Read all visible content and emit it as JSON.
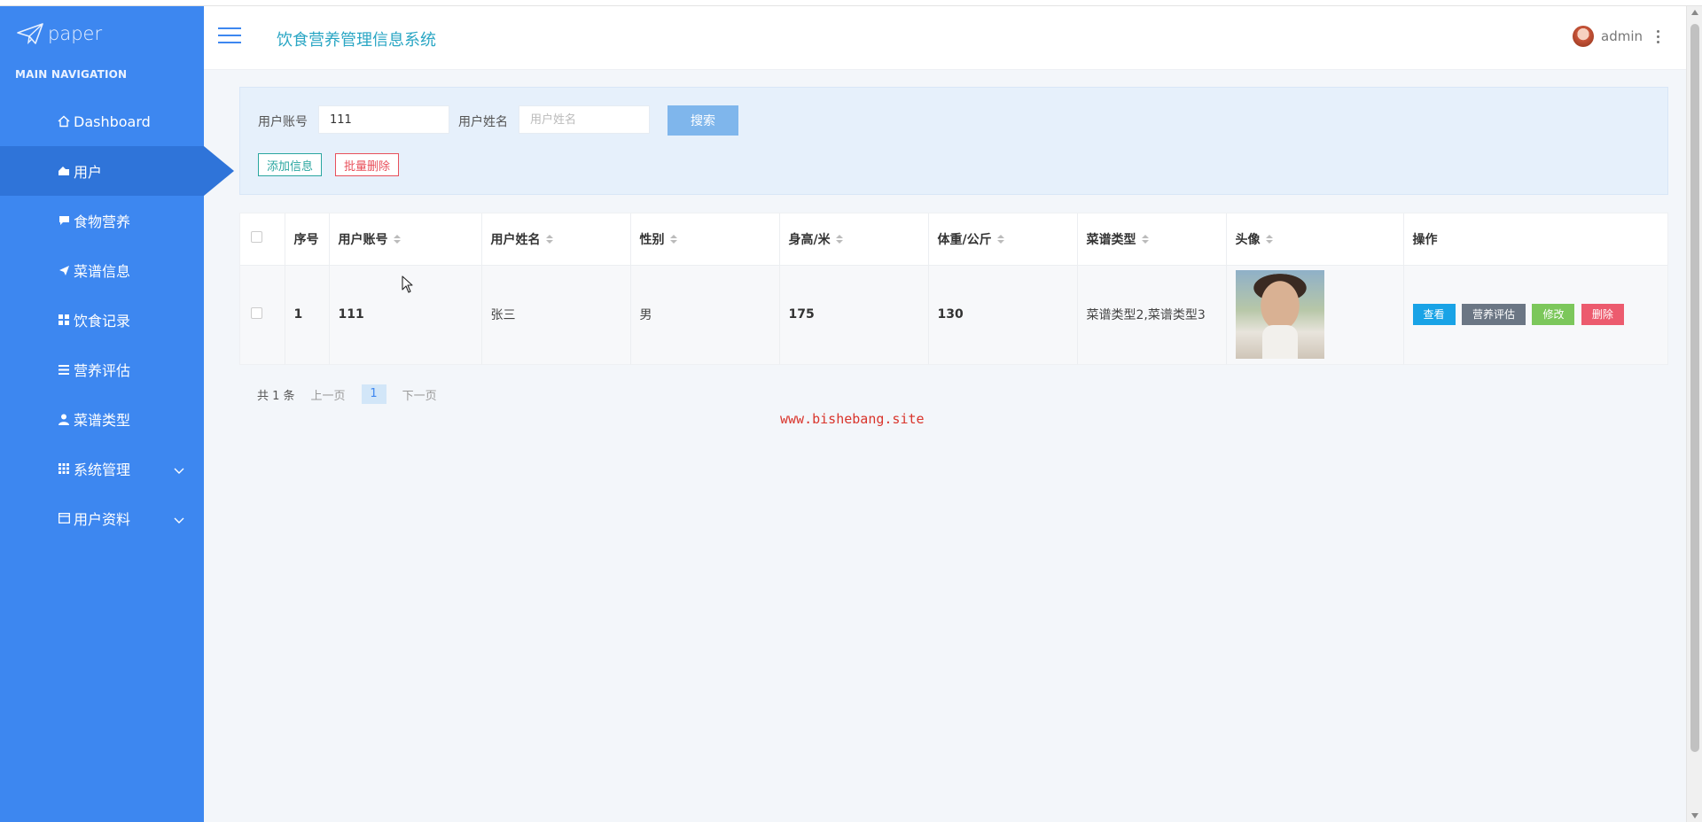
{
  "app": {
    "logo_text": "paper",
    "title": "饮食营养管理信息系统",
    "user_name": "admin"
  },
  "sidebar": {
    "heading": "MAIN NAVIGATION",
    "items": [
      {
        "label": "Dashboard",
        "icon": "home-icon"
      },
      {
        "label": "用户",
        "icon": "user-house-icon"
      },
      {
        "label": "食物营养",
        "icon": "comment-icon"
      },
      {
        "label": "菜谱信息",
        "icon": "paper-plane-icon"
      },
      {
        "label": "饮食记录",
        "icon": "grid-icon"
      },
      {
        "label": "营养评估",
        "icon": "list-icon"
      },
      {
        "label": "菜谱类型",
        "icon": "person-icon"
      },
      {
        "label": "系统管理",
        "icon": "table-icon"
      },
      {
        "label": "用户资料",
        "icon": "card-icon"
      }
    ],
    "active_index": 1
  },
  "search": {
    "account_label": "用户账号",
    "account_value": "111",
    "name_label": "用户姓名",
    "name_placeholder": "用户姓名",
    "search_btn": "搜索",
    "add_btn": "添加信息",
    "batch_delete_btn": "批量删除"
  },
  "table": {
    "headers": [
      "序号",
      "用户账号",
      "用户姓名",
      "性别",
      "身高/米",
      "体重/公斤",
      "菜谱类型",
      "头像",
      "操作"
    ],
    "rows": [
      {
        "index": "1",
        "account": "111",
        "name": "张三",
        "gender": "男",
        "height": "175",
        "weight": "130",
        "recipe_type": "菜谱类型2,菜谱类型3",
        "ops": {
          "view": "查看",
          "eval": "营养评估",
          "edit": "修改",
          "delete": "删除"
        }
      }
    ]
  },
  "pager": {
    "total": "共 1 条",
    "prev": "上一页",
    "current": "1",
    "next": "下一页"
  },
  "watermark": "www.bishebang.site",
  "colors": {
    "sidebar": "#3d87f0",
    "sidebar_active": "#2f74d9",
    "title": "#2aa6c4",
    "view": "#19a3e6",
    "eval": "#6b7684",
    "edit": "#7cc75b",
    "delete": "#ec5b6e"
  }
}
